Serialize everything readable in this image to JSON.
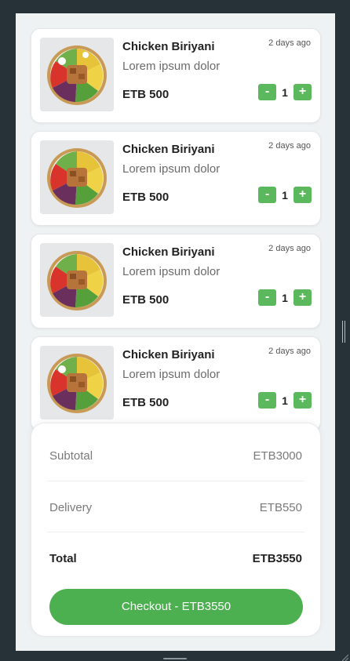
{
  "cart": {
    "items": [
      {
        "name": "Chicken Biriyani",
        "description": "Lorem ipsum dolor",
        "price": "ETB 500",
        "time": "2 days ago",
        "quantity": "1",
        "minus": "-",
        "plus": "+"
      },
      {
        "name": "Chicken Biriyani",
        "description": "Lorem ipsum dolor",
        "price": "ETB 500",
        "time": "2 days ago",
        "quantity": "1",
        "minus": "-",
        "plus": "+"
      },
      {
        "name": "Chicken Biriyani",
        "description": "Lorem ipsum dolor",
        "price": "ETB 500",
        "time": "2 days ago",
        "quantity": "1",
        "minus": "-",
        "plus": "+"
      },
      {
        "name": "Chicken Biriyani",
        "description": "Lorem ipsum dolor",
        "price": "ETB 500",
        "time": "2 days ago",
        "quantity": "1",
        "minus": "-",
        "plus": "+"
      }
    ]
  },
  "summary": {
    "subtotal_label": "Subtotal",
    "subtotal_value": "ETB3000",
    "delivery_label": "Delivery",
    "delivery_value": "ETB550",
    "total_label": "Total",
    "total_value": "ETB3550",
    "checkout_label": "Checkout - ETB3550"
  },
  "colors": {
    "accent": "#4caf50",
    "stepper": "#5cb85c",
    "background": "#263238"
  }
}
